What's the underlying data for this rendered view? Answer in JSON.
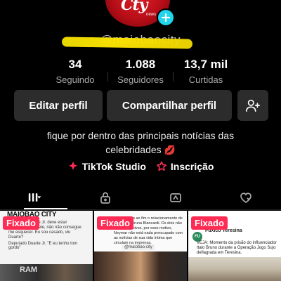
{
  "profile": {
    "avatar_logo": "Cty",
    "avatar_logo_sub": "news",
    "username": "@maiobaocity"
  },
  "stats": [
    {
      "value": "34",
      "label": "Seguindo"
    },
    {
      "value": "1.088",
      "label": "Seguidores"
    },
    {
      "value": "13,7 mil",
      "label": "Curtidas"
    }
  ],
  "actions": {
    "edit_label": "Editar perfil",
    "share_label": "Compartilhar perfil"
  },
  "bio": {
    "text": "fique por dentro das principais notícias das celebridades",
    "emoji": "💋"
  },
  "links": {
    "studio_label": "TikTok Studio",
    "subscription_label": "Inscrição"
  },
  "tabs": [
    {
      "icon": "grid-icon",
      "active": true
    },
    {
      "icon": "lock-icon",
      "active": false
    },
    {
      "icon": "repost-icon",
      "active": false
    },
    {
      "icon": "liked-heart-icon",
      "active": false
    }
  ],
  "colors": {
    "accent_pink": "#fe2c55",
    "add_badge": "#20d5ec",
    "button_bg": "#2c2c2c"
  },
  "videos": [
    {
      "pinned_label": "Fixado",
      "brand": "MAIOBAO CITY",
      "caption": "Deputado Duarte Jr. deve estar apaixonado por ele, não não consegue me esquecer. Eu sou casado, viu Duarte?",
      "caption2": "Deputado Duarte Jr. \"E eu tenho tom gordo\"",
      "photo_text": "RAM"
    },
    {
      "pinned_label": "Fixado",
      "caption": "Yuri Chagas ao fim o relacionamento de Neymar e Bruna Biancardi. Os dois não são mais noivos, por esse motivo, Neymar não está nada preocupado com as notícias de sua vida íntima que circulam na imprensa.",
      "tag": "@maiobao.city"
    },
    {
      "pinned_label": "Fixado",
      "source": "Fuxico Teresina",
      "source_sub": "FU",
      "caption": "VEJA: Momento da prisão do influenciador Italo Bruno durante a Operação Jogo Sujo deflagrada em Teresina."
    }
  ]
}
